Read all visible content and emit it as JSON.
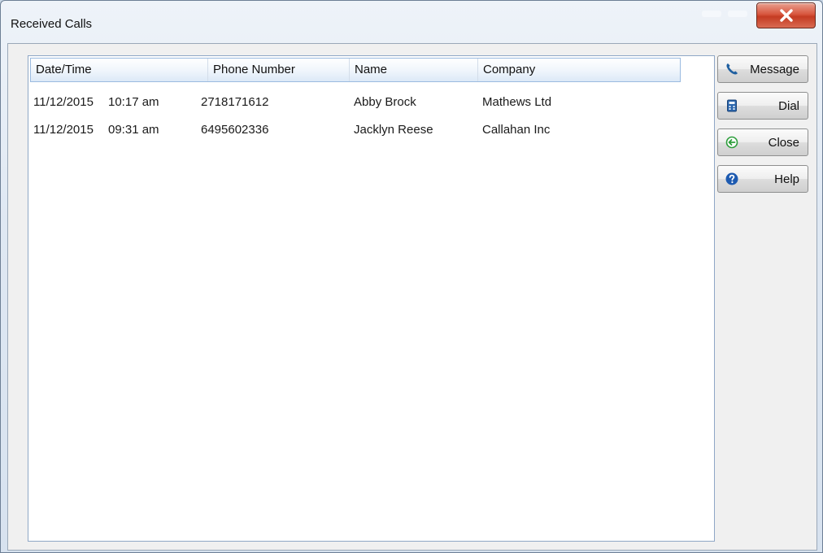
{
  "window": {
    "title": "Received Calls"
  },
  "columns": [
    "Date/Time",
    "Phone Number",
    "Name",
    "Company"
  ],
  "rows": [
    {
      "date": "11/12/2015",
      "time": "10:17 am",
      "phone": "2718171612",
      "name": "Abby Brock",
      "company": "Mathews Ltd"
    },
    {
      "date": "11/12/2015",
      "time": "09:31 am",
      "phone": "6495602336",
      "name": "Jacklyn Reese",
      "company": "Callahan Inc"
    }
  ],
  "buttons": {
    "message": "Message",
    "dial": "Dial",
    "close": "Close",
    "help": "Help"
  },
  "icons": {
    "message": "phone-handset-icon",
    "dial": "calculator-icon",
    "close": "back-arrow-icon",
    "help": "help-icon",
    "window_close": "close-icon"
  },
  "colors": {
    "title_close": "#c43b22",
    "header_border": "#9bbbe0",
    "phone_icon": "#1f5fa0",
    "close_icon": "#2e9e3c",
    "help_icon": "#1d5ab0"
  }
}
